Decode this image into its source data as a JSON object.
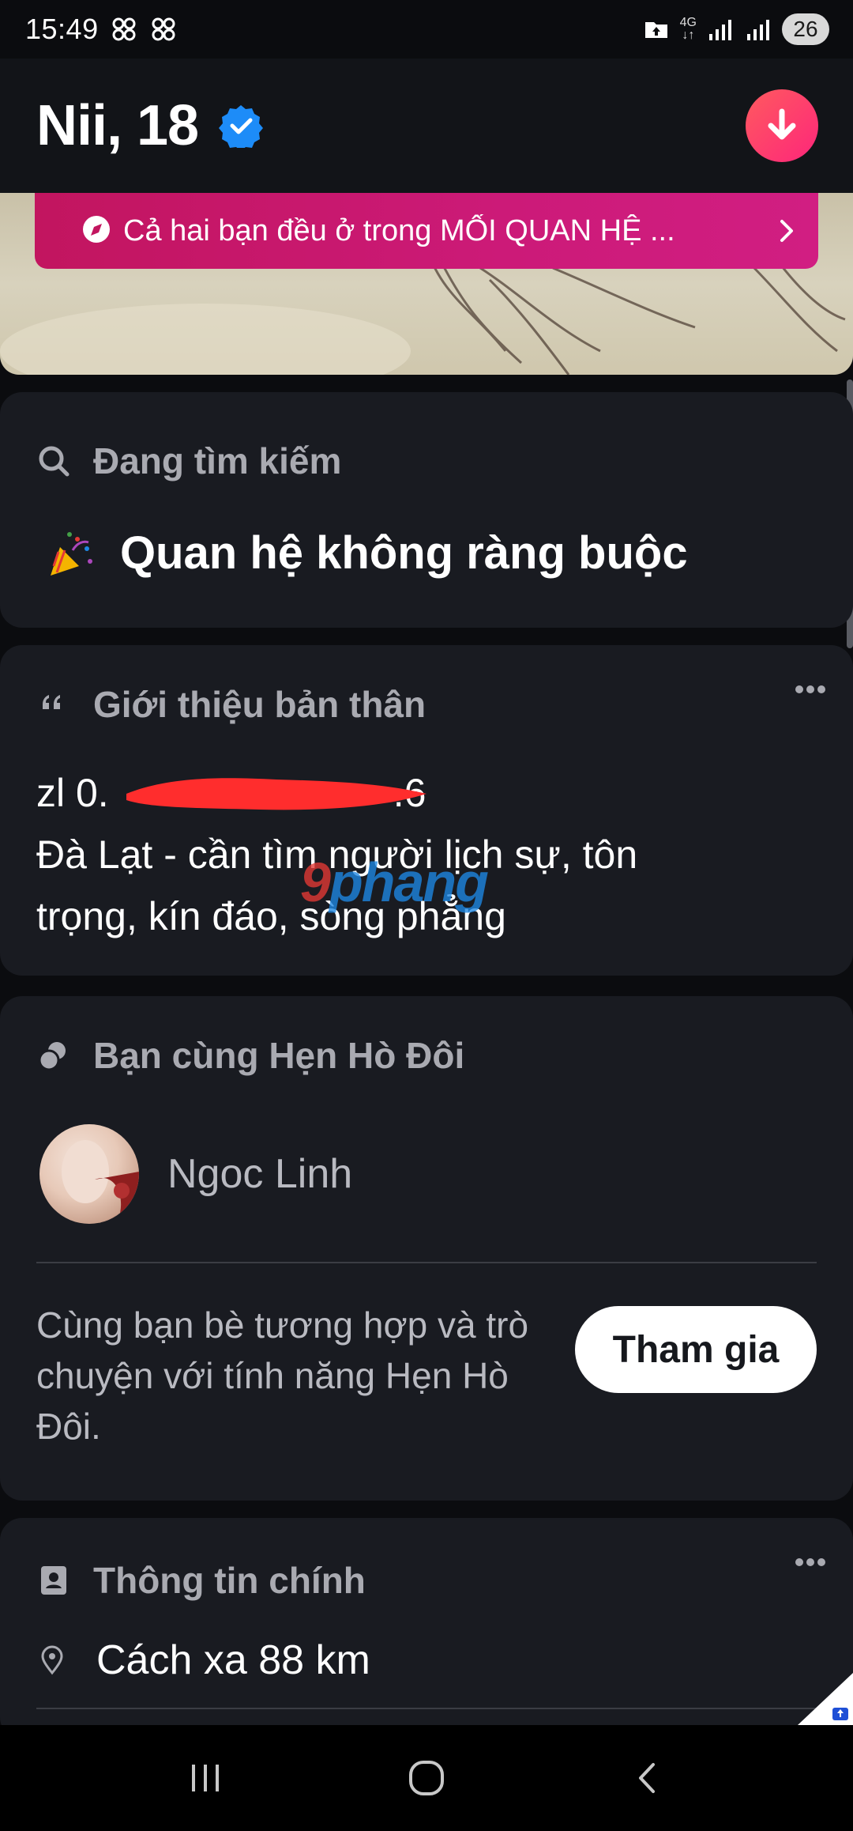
{
  "status_bar": {
    "time": "15:49",
    "network": "4G",
    "battery": "26"
  },
  "profile": {
    "name_age": "Nii, 18"
  },
  "banner": {
    "text": "Cả hai bạn đều ở trong MỐI QUAN HỆ ..."
  },
  "looking_for": {
    "title": "Đang tìm kiếm",
    "value": "Quan hệ không ràng buộc"
  },
  "bio": {
    "title": "Giới thiệu bản thân",
    "line1": "zl 0.",
    "line1_tail": ".6",
    "line2": "Đà Lạt - cần tìm người lịch sự, tôn",
    "line3": "trọng, kín đáo, sòng phẳng",
    "watermark_1": "9",
    "watermark_2": "phang"
  },
  "double_date": {
    "title": "Bạn cùng Hẹn Hò Đôi",
    "friend_name": "Ngoc Linh",
    "description": "Cùng bạn bè tương hợp và trò chuyện với tính năng Hẹn Hò Đôi.",
    "join_label": "Tham gia"
  },
  "main_info": {
    "title": "Thông tin chính",
    "distance": "Cách xa 88 km"
  },
  "colors": {
    "background": "#0b0c0f",
    "card": "#191b21",
    "banner": "#c2155f",
    "accent_gradient_start": "#ff5a5f",
    "accent_gradient_end": "#fd267a",
    "verified_blue": "#1d8cf8"
  },
  "icons": {
    "verified": "verified-check-icon",
    "download": "arrow-down-icon",
    "compass": "compass-icon",
    "search": "search-icon",
    "quote": "quote-icon",
    "double_date": "double-date-icon",
    "id_card": "id-card-icon",
    "location": "location-pin-icon",
    "more": "more-dots-icon"
  }
}
